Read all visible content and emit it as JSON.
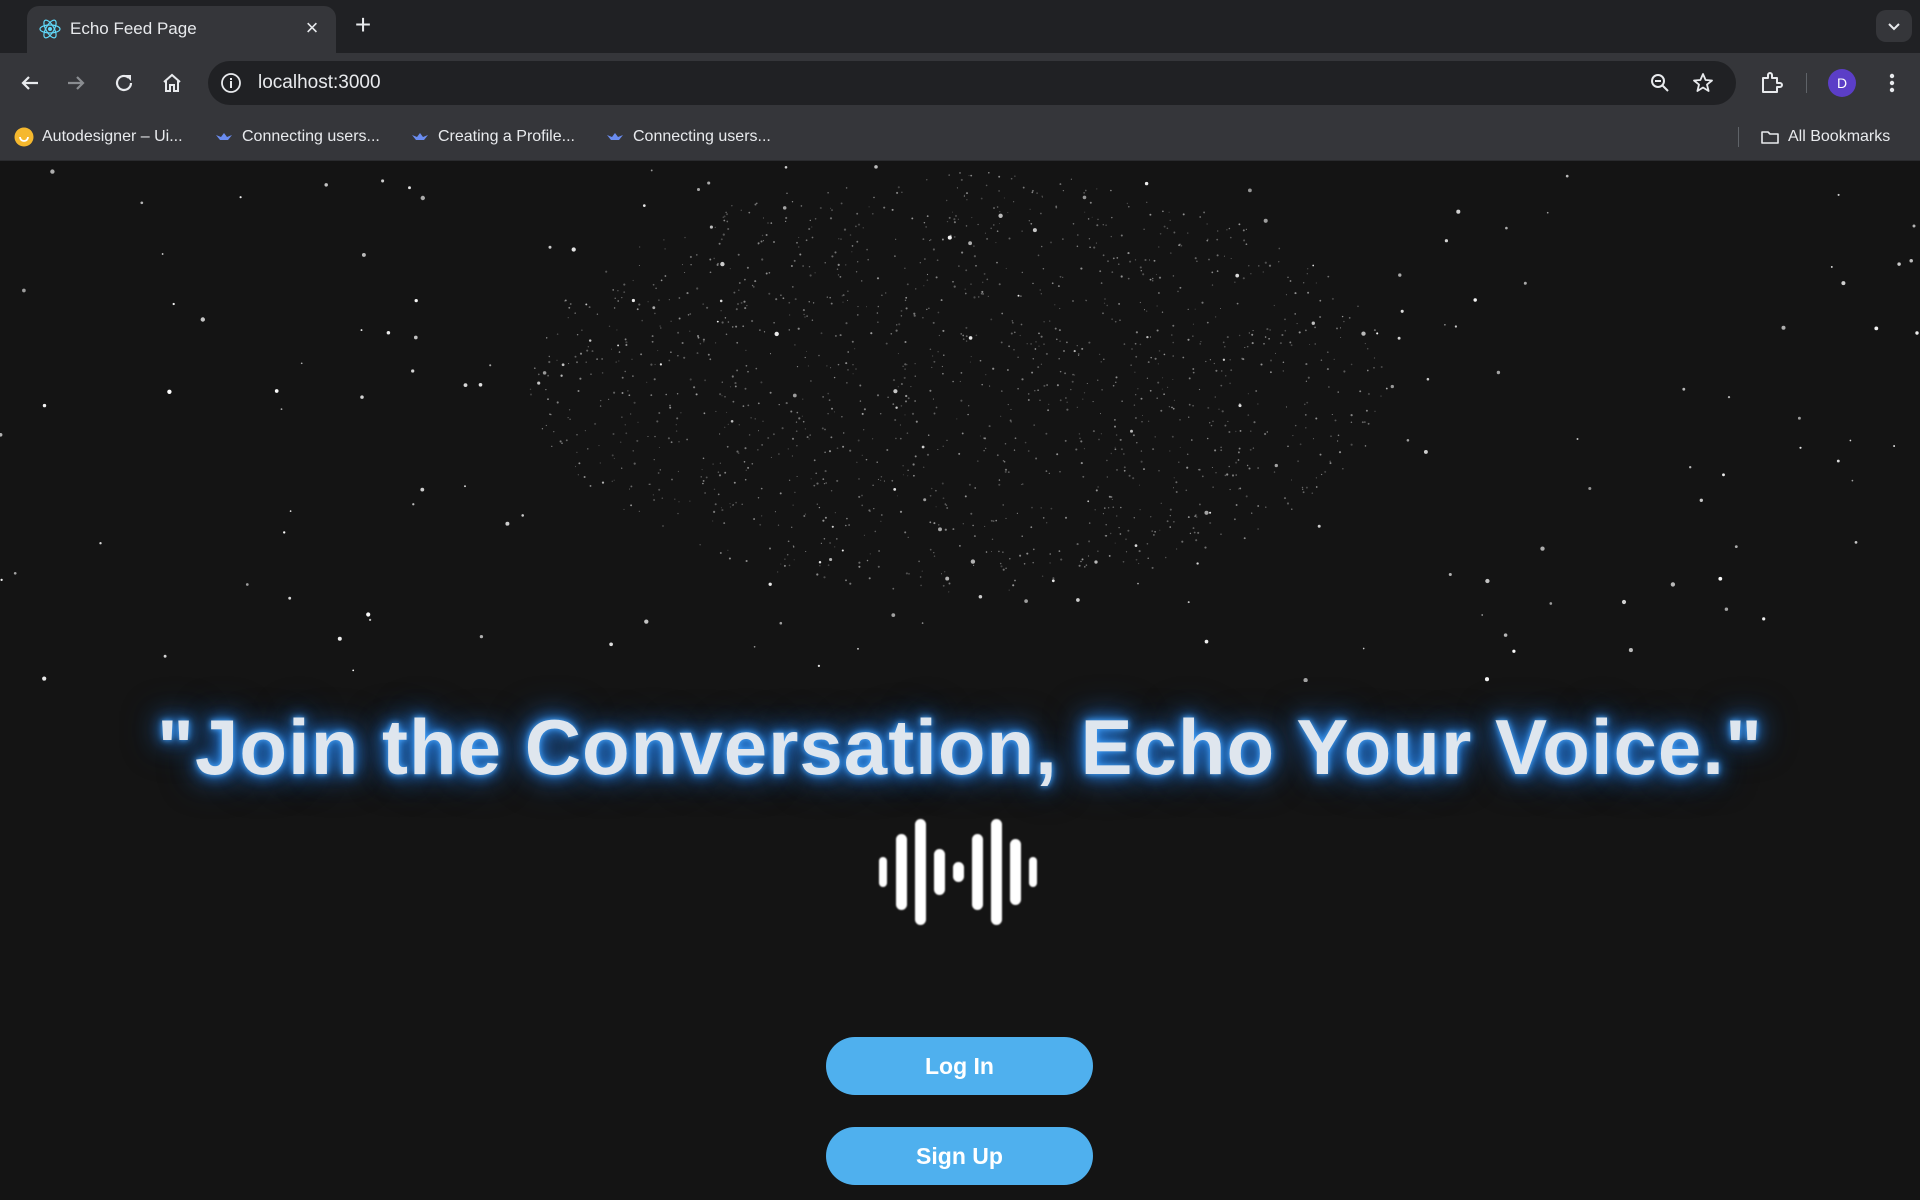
{
  "browser": {
    "tab": {
      "title": "Echo Feed Page",
      "favicon": "react-icon",
      "close": "×"
    },
    "new_tab": "+",
    "omnibox": {
      "url": "localhost:3000"
    },
    "profile_initial": "D",
    "bookmarks": [
      {
        "label": "Autodesigner – Ui...",
        "icon": "smiley-icon"
      },
      {
        "label": "Connecting users...",
        "icon": "bird-icon"
      },
      {
        "label": "Creating a Profile...",
        "icon": "bird-icon"
      },
      {
        "label": "Connecting users...",
        "icon": "bird-icon"
      }
    ],
    "all_bookmarks": "All Bookmarks"
  },
  "hero": {
    "headline": "\"Join the Conversation, Echo Your Voice.\"",
    "icon": "sound-wave-icon"
  },
  "actions": {
    "login_label": "Log In",
    "signup_label": "Sign Up"
  },
  "colors": {
    "background": "#141414",
    "button": "#4fb0ee",
    "glow": "#2d8cf0",
    "headline": "#dfe6ee"
  }
}
